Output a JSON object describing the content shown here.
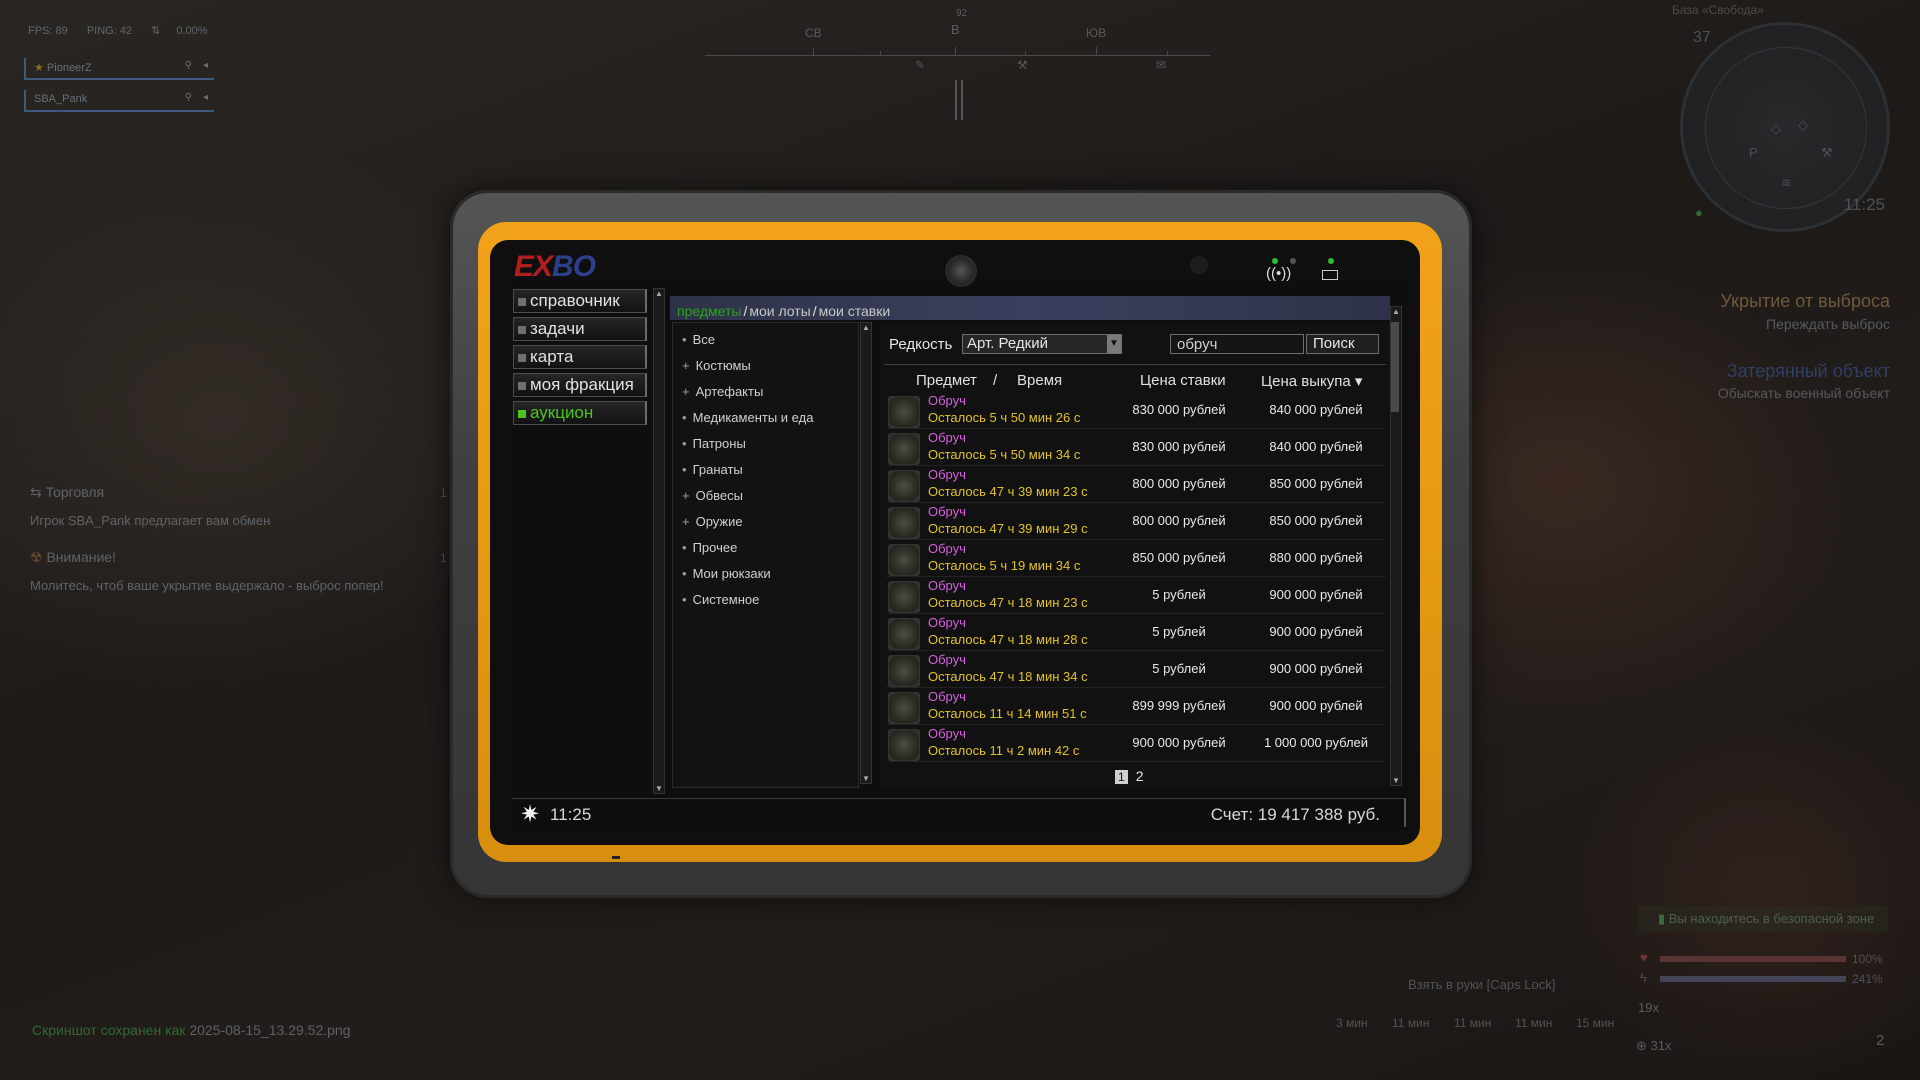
{
  "hud": {
    "fps": "FPS: 89",
    "ping": "PING: 42",
    "loss": "0.00%",
    "squad": [
      {
        "name": "PioneerZ"
      },
      {
        "name": "SBA_Pank"
      }
    ]
  },
  "compass": {
    "labels": [
      "СВ",
      "В",
      "ЮВ"
    ],
    "bearing": "92"
  },
  "minimap": {
    "base_name": "База «Свобода»",
    "level": "37",
    "time": "11:25"
  },
  "tasks": [
    {
      "title": "Укрытие от выброса",
      "subtitle": "Переждать выброс",
      "color": "#6e5a3a"
    },
    {
      "title": "Затерянный объект",
      "subtitle": "Обыскать военный объект",
      "color": "#2f3f66"
    }
  ],
  "chat": {
    "trade_header": "Торговля",
    "trade_count": "1",
    "trade_message": "Игрок SBA_Pank предлагает вам обмен",
    "alert_header": "Внимание!",
    "alert_count": "1",
    "alert_message": "Молитесь, чтоб ваше укрытие выдержало - выброс попер!"
  },
  "screenshot_saved": {
    "prefix": "Скриншот сохранен как",
    "file": "2025-08-15_13.29.52.png"
  },
  "bottom_hud": {
    "safe_zone": "Вы находитесь в безопасной зоне",
    "health_pct": "100%",
    "stamina_pct": "241%",
    "health_level": 1.0,
    "stamina_level": 1.0,
    "take_hint": "Взять в руки [Caps Lock]",
    "timers": [
      "3 мин",
      "11 мин",
      "11 мин",
      "11 мин",
      "15 мин"
    ],
    "grenade_count": "19x",
    "ammo_count": "31x",
    "slot_number": "2"
  },
  "tablet": {
    "logo_e": "E",
    "logo_x": "X",
    "logo_bo": "BO",
    "menu": [
      {
        "label": "справочник",
        "active": false
      },
      {
        "label": "задачи",
        "active": false
      },
      {
        "label": "карта",
        "active": false
      },
      {
        "label": "моя фракция",
        "active": false
      },
      {
        "label": "аукцион",
        "active": true
      }
    ],
    "tabs": {
      "items": "предметы",
      "my_lots": "мои лоты",
      "my_bids": "мои ставки",
      "sep": "/"
    },
    "categories": [
      {
        "bullet": "•",
        "label": "Все"
      },
      {
        "bullet": "+",
        "label": "Костюмы"
      },
      {
        "bullet": "+",
        "label": "Артефакты"
      },
      {
        "bullet": "•",
        "label": "Медикаменты и еда"
      },
      {
        "bullet": "•",
        "label": "Патроны"
      },
      {
        "bullet": "•",
        "label": "Гранаты"
      },
      {
        "bullet": "+",
        "label": "Обвесы"
      },
      {
        "bullet": "+",
        "label": "Оружие"
      },
      {
        "bullet": "•",
        "label": "Прочее"
      },
      {
        "bullet": "•",
        "label": "Мои рюкзаки"
      },
      {
        "bullet": "•",
        "label": "Системное"
      }
    ],
    "filter": {
      "rarity_label": "Редкость",
      "rarity_value": "Арт. Редкий",
      "search_value": "обруч",
      "search_button": "Поиск"
    },
    "columns": {
      "item": "Предмет",
      "slash": "/",
      "time": "Время",
      "bid": "Цена ставки",
      "buyout": "Цена выкупа ▾"
    },
    "rows": [
      {
        "name": "Обруч",
        "time": "Осталось 5 ч 50 мин 26 с",
        "bid": "830 000 рублей",
        "buyout": "840 000 рублей"
      },
      {
        "name": "Обруч",
        "time": "Осталось 5 ч 50 мин 34 с",
        "bid": "830 000 рублей",
        "buyout": "840 000 рублей"
      },
      {
        "name": "Обруч",
        "time": "Осталось 47 ч 39 мин 23 с",
        "bid": "800 000 рублей",
        "buyout": "850 000 рублей"
      },
      {
        "name": "Обруч",
        "time": "Осталось 47 ч 39 мин 29 с",
        "bid": "800 000 рублей",
        "buyout": "850 000 рублей"
      },
      {
        "name": "Обруч",
        "time": "Осталось 5 ч 19 мин 34 с",
        "bid": "850 000 рублей",
        "buyout": "880 000 рублей"
      },
      {
        "name": "Обруч",
        "time": "Осталось 47 ч 18 мин 23 с",
        "bid": "5 рублей",
        "buyout": "900 000 рублей"
      },
      {
        "name": "Обруч",
        "time": "Осталось 47 ч 18 мин 28 с",
        "bid": "5 рублей",
        "buyout": "900 000 рублей"
      },
      {
        "name": "Обруч",
        "time": "Осталось 47 ч 18 мин 34 с",
        "bid": "5 рублей",
        "buyout": "900 000 рублей"
      },
      {
        "name": "Обруч",
        "time": "Осталось 11 ч 14 мин 51 с",
        "bid": "899 999 рублей",
        "buyout": "900 000 рублей"
      },
      {
        "name": "Обруч",
        "time": "Осталось 11 ч 2 мин 42 с",
        "bid": "900 000 рублей",
        "buyout": "1 000 000 рублей"
      }
    ],
    "pages": {
      "current": "1",
      "next": "2"
    },
    "status": {
      "time": "11:25",
      "account": "Счет: 19 417 388 руб."
    }
  },
  "colors": {
    "tablet_frame": "#e59a12",
    "active_menu": "#4cc51f",
    "item_name": "#d85fe0",
    "time_left": "#e2c22a",
    "logo_red": "#b01e1e",
    "logo_blue": "#2c3f8c"
  }
}
